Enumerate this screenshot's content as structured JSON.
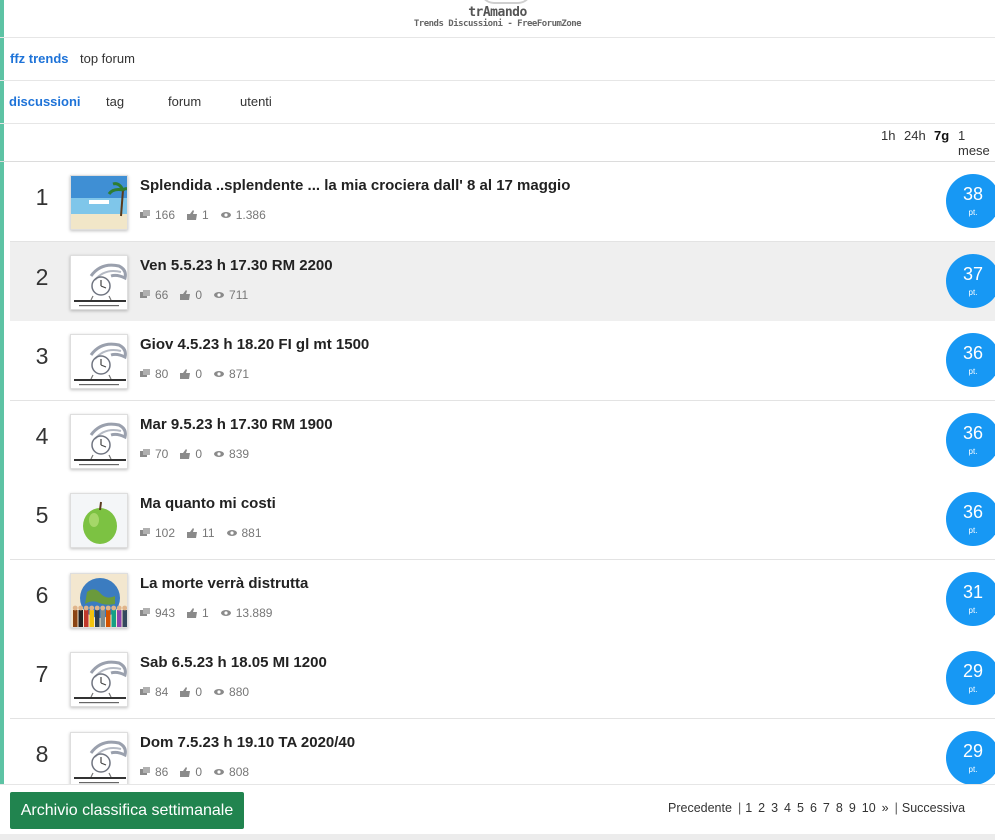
{
  "brand": {
    "title": "trAmando",
    "subtitle": "Trends Discussioni - FreeForumZone"
  },
  "topnav": {
    "active": "ffz trends",
    "other": "top forum"
  },
  "subnav": {
    "items": [
      "discussioni",
      "tag",
      "forum",
      "utenti"
    ]
  },
  "timefilter": {
    "options": [
      "1h",
      "24h",
      "7g",
      "1 mese"
    ],
    "selected": "7g"
  },
  "colors": {
    "accent": "#1e73d8",
    "score_bg": "#1798f4",
    "button_bg": "#21844f",
    "stripe": "#5dc3a4"
  },
  "score_unit": "pt.",
  "rows": [
    {
      "rank": "1",
      "title": "Splendida ..splendente ... la mia crociera dall' 8 al 17 maggio",
      "comments": "166",
      "likes": "1",
      "views": "1.386",
      "score": "38",
      "thumb": "sea-icon"
    },
    {
      "rank": "2",
      "title": "Ven 5.5.23 h 17.30 RM 2200",
      "comments": "66",
      "likes": "0",
      "views": "711",
      "score": "37",
      "thumb": "clock-logo-icon"
    },
    {
      "rank": "3",
      "title": "Giov 4.5.23 h 18.20 FI gl mt 1500",
      "comments": "80",
      "likes": "0",
      "views": "871",
      "score": "36",
      "thumb": "clock-logo-icon"
    },
    {
      "rank": "4",
      "title": "Mar 9.5.23 h 17.30 RM 1900",
      "comments": "70",
      "likes": "0",
      "views": "839",
      "score": "36",
      "thumb": "clock-logo-icon"
    },
    {
      "rank": "5",
      "title": "Ma quanto mi costi",
      "comments": "102",
      "likes": "11",
      "views": "881",
      "score": "36",
      "thumb": "apple-icon"
    },
    {
      "rank": "6",
      "title": "La morte verrà distrutta",
      "comments": "943",
      "likes": "1",
      "views": "13.889",
      "score": "31",
      "thumb": "globe-people-icon"
    },
    {
      "rank": "7",
      "title": "Sab 6.5.23 h 18.05 MI 1200",
      "comments": "84",
      "likes": "0",
      "views": "880",
      "score": "29",
      "thumb": "clock-logo-icon"
    },
    {
      "rank": "8",
      "title": "Dom 7.5.23 h 19.10 TA 2020/40",
      "comments": "86",
      "likes": "0",
      "views": "808",
      "score": "29",
      "thumb": "clock-logo-icon"
    }
  ],
  "bottom": {
    "archive_label": "Archivio classifica settimanale",
    "pager": {
      "prev": "Precedente",
      "pages": [
        "1",
        "2",
        "3",
        "4",
        "5",
        "6",
        "7",
        "8",
        "9",
        "10"
      ],
      "more": "»",
      "next": "Successiva"
    }
  }
}
